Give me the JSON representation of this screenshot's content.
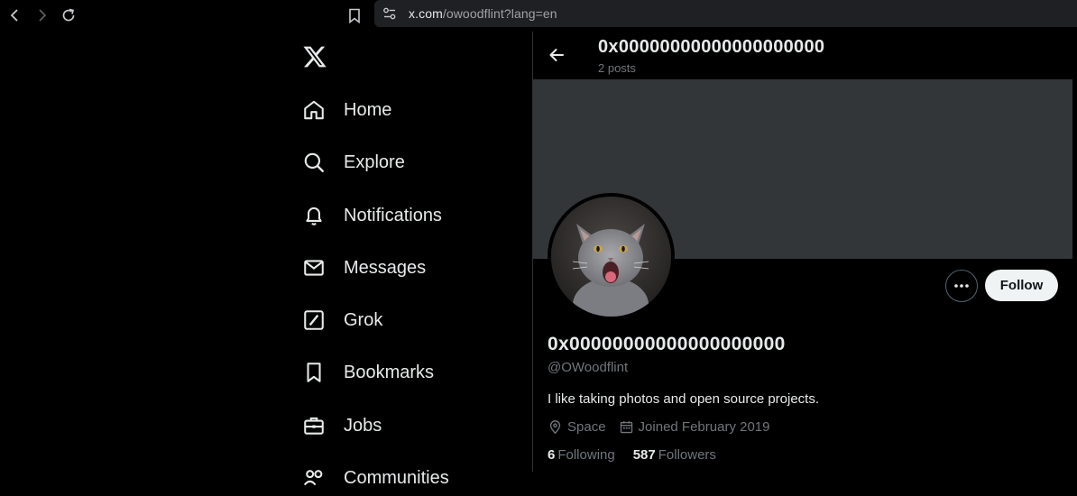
{
  "browser": {
    "url_host": "x.com",
    "url_rest": "/owoodflint?lang=en"
  },
  "sidebar": {
    "items": [
      {
        "label": "Home",
        "icon": "home-icon"
      },
      {
        "label": "Explore",
        "icon": "search-icon"
      },
      {
        "label": "Notifications",
        "icon": "bell-icon"
      },
      {
        "label": "Messages",
        "icon": "envelope-icon"
      },
      {
        "label": "Grok",
        "icon": "grok-icon"
      },
      {
        "label": "Bookmarks",
        "icon": "bookmark-icon"
      },
      {
        "label": "Jobs",
        "icon": "briefcase-icon"
      },
      {
        "label": "Communities",
        "icon": "people-icon"
      }
    ]
  },
  "header": {
    "name": "0x00000000000000000000",
    "post_count": "2 posts"
  },
  "profile": {
    "display_name": "0x00000000000000000000",
    "handle": "@OWoodflint",
    "bio": "I like taking photos and open source projects.",
    "location": "Space",
    "joined": "Joined February 2019",
    "following_count": "6",
    "following_label": "Following",
    "followers_count": "587",
    "followers_label": "Followers",
    "follow_label": "Follow"
  },
  "colors": {
    "background": "#000000",
    "banner": "#333639",
    "text": "#e7e9ea",
    "secondary": "#71767b",
    "follow_bg": "#eff3f4"
  }
}
